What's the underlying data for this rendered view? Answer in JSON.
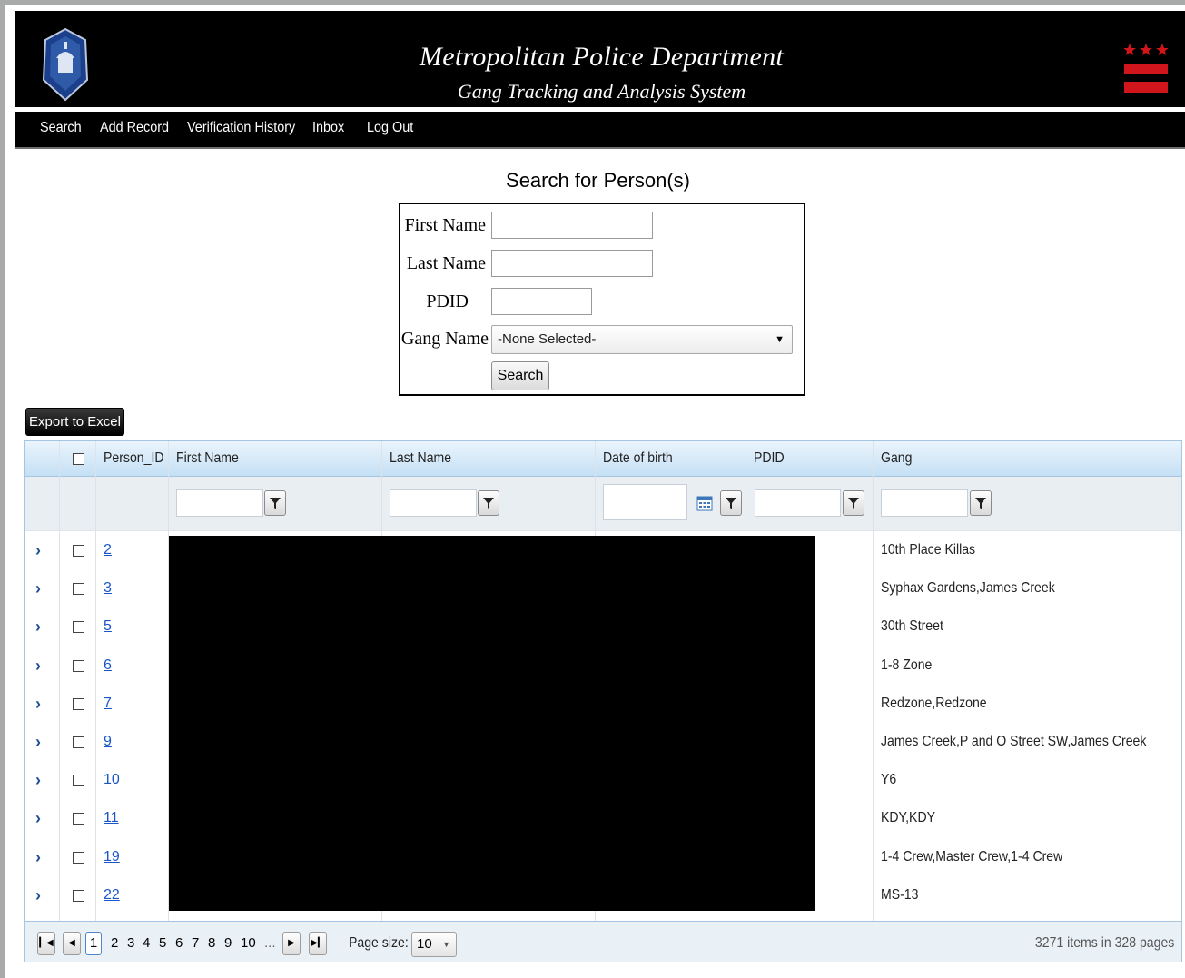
{
  "header": {
    "title": "Metropolitan Police Department",
    "subtitle": "Gang Tracking and Analysis System"
  },
  "nav": {
    "search": "Search",
    "add_record": "Add Record",
    "verification_history": "Verification History",
    "inbox": "Inbox",
    "log_out": "Log Out"
  },
  "search_form": {
    "title": "Search for Person(s)",
    "first_name_label": "First Name",
    "last_name_label": "Last Name",
    "pdid_label": "PDID",
    "gang_name_label": "Gang Name",
    "first_name_value": "",
    "last_name_value": "",
    "pdid_value": "",
    "gang_name_selected": "-None Selected-",
    "search_button": "Search"
  },
  "export_button": "Export to Excel",
  "grid": {
    "columns": {
      "person_id": "Person_ID",
      "first_name": "First Name",
      "last_name": "Last Name",
      "dob": "Date of birth",
      "pdid": "PDID",
      "gang": "Gang"
    },
    "rows": [
      {
        "id": "2",
        "gang": "10th Place Killas"
      },
      {
        "id": "3",
        "gang": "Syphax Gardens,James Creek"
      },
      {
        "id": "5",
        "gang": "30th Street"
      },
      {
        "id": "6",
        "gang": "1-8 Zone"
      },
      {
        "id": "7",
        "gang": "Redzone,Redzone"
      },
      {
        "id": "9",
        "gang": "James Creek,P and O Street SW,James Creek"
      },
      {
        "id": "10",
        "gang": "Y6"
      },
      {
        "id": "11",
        "gang": "KDY,KDY"
      },
      {
        "id": "19",
        "gang": "1-4 Crew,Master Crew,1-4 Crew"
      },
      {
        "id": "22",
        "gang": "MS-13"
      }
    ]
  },
  "pager": {
    "current_page": "1",
    "pages": [
      "2",
      "3",
      "4",
      "5",
      "6",
      "7",
      "8",
      "9",
      "10",
      "..."
    ],
    "page_size_label": "Page size:",
    "page_size": "10",
    "info": "3271 items in 328 pages"
  },
  "colors": {
    "header_bg": "#000000",
    "grid_header": "#c5e0f5",
    "link": "#1a56c7",
    "flag_red": "#d0151c"
  }
}
